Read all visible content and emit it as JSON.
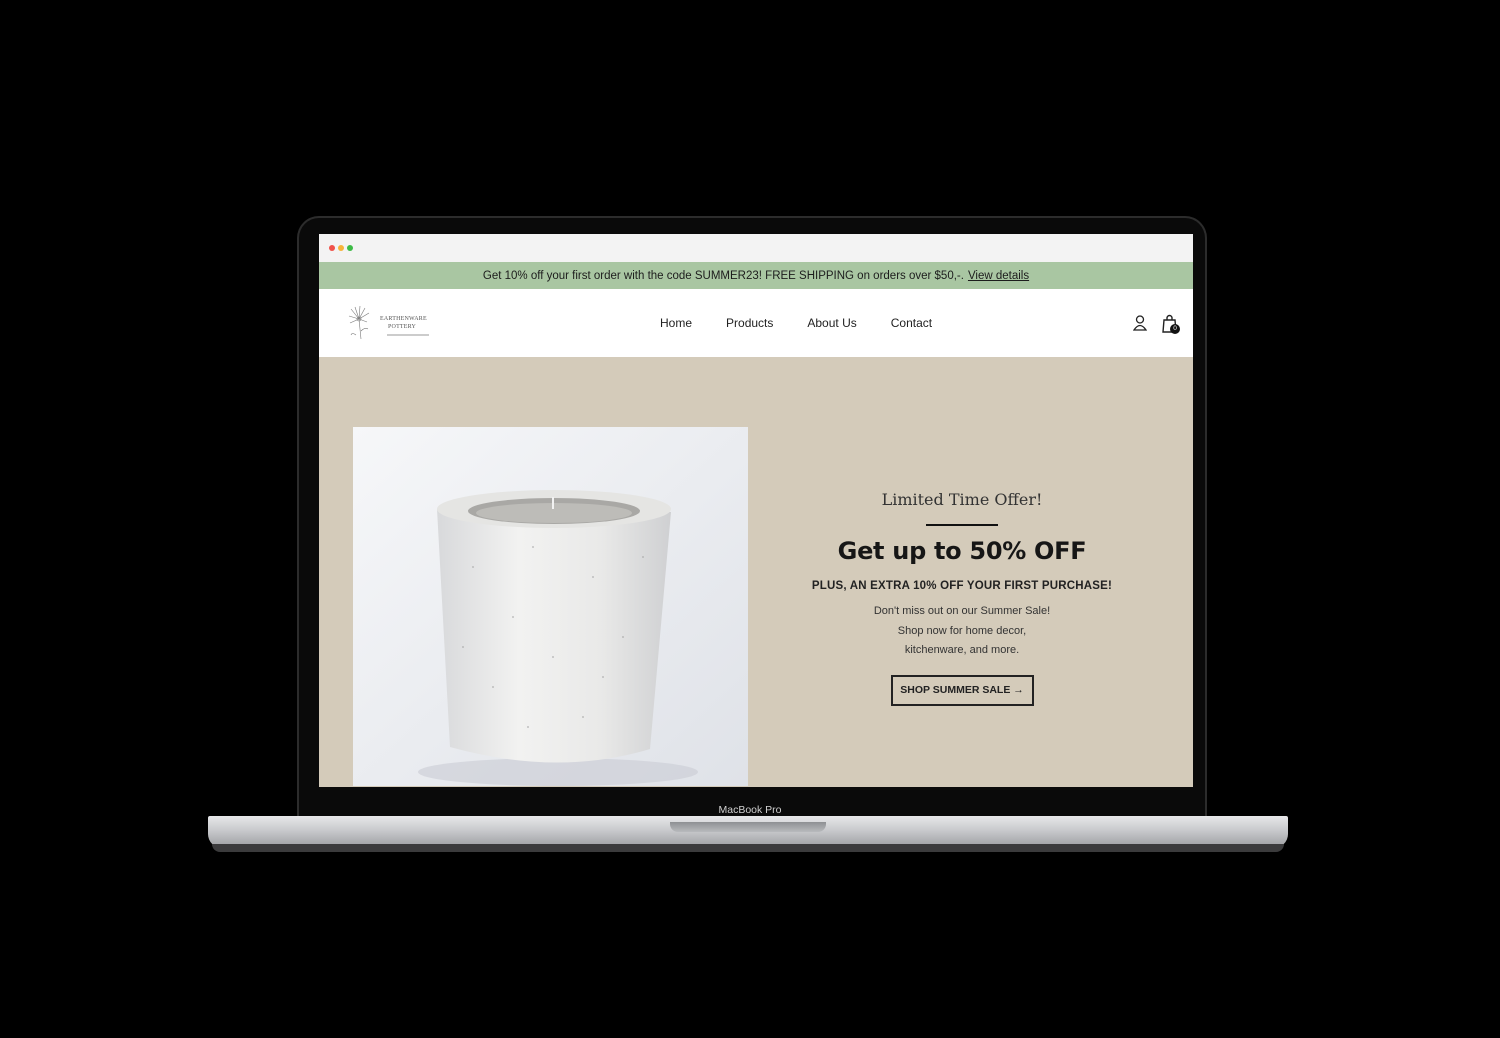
{
  "device": {
    "label": "MacBook Pro"
  },
  "announcement": {
    "text": "Get 10% off your first order with the code SUMMER23! FREE SHIPPING on orders over $50,-.",
    "link": "View details"
  },
  "header": {
    "logo_lines": [
      "EARTHENWARE",
      "POTTERY"
    ],
    "nav": [
      "Home",
      "Products",
      "About Us",
      "Contact"
    ],
    "cart_count": "0"
  },
  "hero": {
    "kicker": "Limited Time Offer!",
    "headline": "Get up to 50% OFF",
    "subheadline": "PLUS, AN EXTRA 10% OFF YOUR FIRST PURCHASE!",
    "body": [
      "Don't miss out on our Summer Sale!",
      "Shop now for home decor,",
      "kitchenware, and more."
    ],
    "cta": "SHOP SUMMER SALE →"
  },
  "colors": {
    "announcement_bg": "#a9c6a2",
    "hero_bg": "#d4cbba",
    "text": "#161616"
  },
  "icons": [
    "user-icon",
    "shopping-bag-icon",
    "close-dot",
    "minimize-dot",
    "maximize-dot"
  ]
}
